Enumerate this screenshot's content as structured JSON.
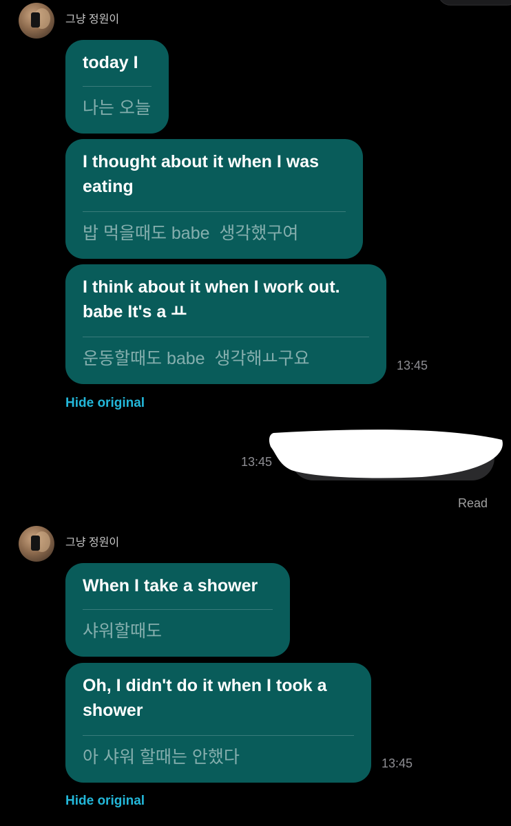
{
  "conversation": {
    "contact_name": "그냥 정원이",
    "groups": [
      {
        "sender": "그냥 정원이",
        "messages": [
          {
            "translation": "today I",
            "original": "나는 오늘"
          },
          {
            "translation": "I thought about it when I was\neating",
            "original": "밥 먹을때도 babe  생각했구여"
          },
          {
            "translation": "I think about it when I work out.\nbabe  It's a ㅛ",
            "original": "운동할때도 babe  생각해ㅛ구요",
            "time": "13:45"
          }
        ],
        "hide_original_label": "Hide original"
      },
      {
        "sender": "그냥 정원이",
        "messages": [
          {
            "translation": "When I take a shower",
            "original": "샤워할때도"
          },
          {
            "translation": "Oh, I didn't do it when I took a\nshower",
            "original": "아 샤워 할때는 안했다",
            "time": "13:45"
          }
        ],
        "hide_original_label": "Hide original"
      }
    ],
    "sent_message": {
      "time": "13:45",
      "status": "Read",
      "content_redacted": true
    }
  },
  "icons": {
    "avatar": "contact-avatar-photo"
  },
  "colors": {
    "background": "#000000",
    "received_bubble": "#095c5a",
    "sent_bubble": "#2a2a2c",
    "link": "#23b7d9",
    "timestamp": "#8e8e93"
  }
}
